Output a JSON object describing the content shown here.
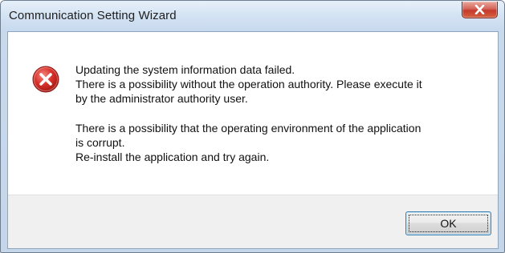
{
  "window": {
    "title": "Communication Setting Wizard",
    "close_icon": "close-icon"
  },
  "dialog": {
    "icon": "error-icon",
    "icon_color": "#d9302a",
    "message_lines_1": [
      "Updating the system information data failed.",
      "There is a possibility without the operation authority. Please execute it",
      "by the administrator authority user."
    ],
    "message_lines_2": [
      "There is a possibility that the operating environment of the application",
      "is corrupt.",
      "Re-install the application and try again."
    ]
  },
  "buttons": {
    "ok_label": "OK"
  }
}
